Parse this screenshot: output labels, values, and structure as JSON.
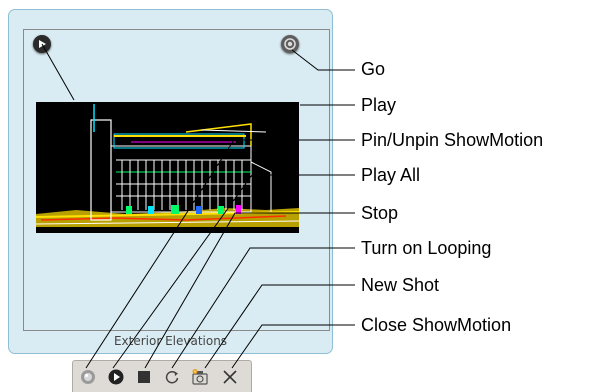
{
  "showmotion": {
    "thumbnail_label": "Exterior Elevations",
    "icons": {
      "play": "play-icon",
      "go": "go-icon",
      "pin": "pin-icon",
      "play_all": "play-all-icon",
      "stop": "stop-icon",
      "loop": "loop-icon",
      "new_shot": "camera-icon",
      "close": "close-icon"
    }
  },
  "callouts": {
    "go": "Go",
    "play": "Play",
    "pin": "Pin/Unpin ShowMotion",
    "play_all": "Play All",
    "stop": "Stop",
    "loop": "Turn on Looping",
    "new_shot": "New Shot",
    "close": "Close ShowMotion"
  }
}
